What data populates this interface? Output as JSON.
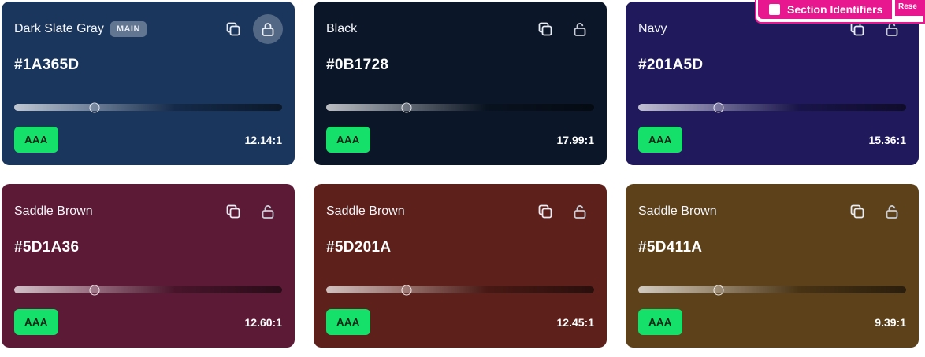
{
  "cards": [
    {
      "name": "Dark Slate Gray",
      "badge": "MAIN",
      "hex": "#1A365D",
      "bg": "#1A365D",
      "slider": 0.3,
      "rating": "AAA",
      "ratio": "12.14:1",
      "lock_active": true,
      "lock_locked": true
    },
    {
      "name": "Black",
      "badge": "",
      "hex": "#0B1728",
      "bg": "#0B1728",
      "slider": 0.3,
      "rating": "AAA",
      "ratio": "17.99:1",
      "lock_active": false,
      "lock_locked": false
    },
    {
      "name": "Navy",
      "badge": "",
      "hex": "#201A5D",
      "bg": "#201A5D",
      "slider": 0.3,
      "rating": "AAA",
      "ratio": "15.36:1",
      "lock_active": false,
      "lock_locked": false
    },
    {
      "name": "Saddle Brown",
      "badge": "",
      "hex": "#5D1A36",
      "bg": "#5D1A36",
      "slider": 0.3,
      "rating": "AAA",
      "ratio": "12.60:1",
      "lock_active": false,
      "lock_locked": false
    },
    {
      "name": "Saddle Brown",
      "badge": "",
      "hex": "#5D201A",
      "bg": "#5D201A",
      "slider": 0.3,
      "rating": "AAA",
      "ratio": "12.45:1",
      "lock_active": false,
      "lock_locked": false
    },
    {
      "name": "Saddle Brown",
      "badge": "",
      "hex": "#5D411A",
      "bg": "#5D411A",
      "slider": 0.3,
      "rating": "AAA",
      "ratio": "9.39:1",
      "lock_active": false,
      "lock_locked": false
    }
  ],
  "overlay": {
    "checkbox_label": "Section Identifiers",
    "reset_label": "Rese",
    "accent": "#E8178F"
  },
  "icons": {
    "copy": "copy-icon",
    "lock": "lock-icon",
    "unlock": "unlock-icon"
  }
}
